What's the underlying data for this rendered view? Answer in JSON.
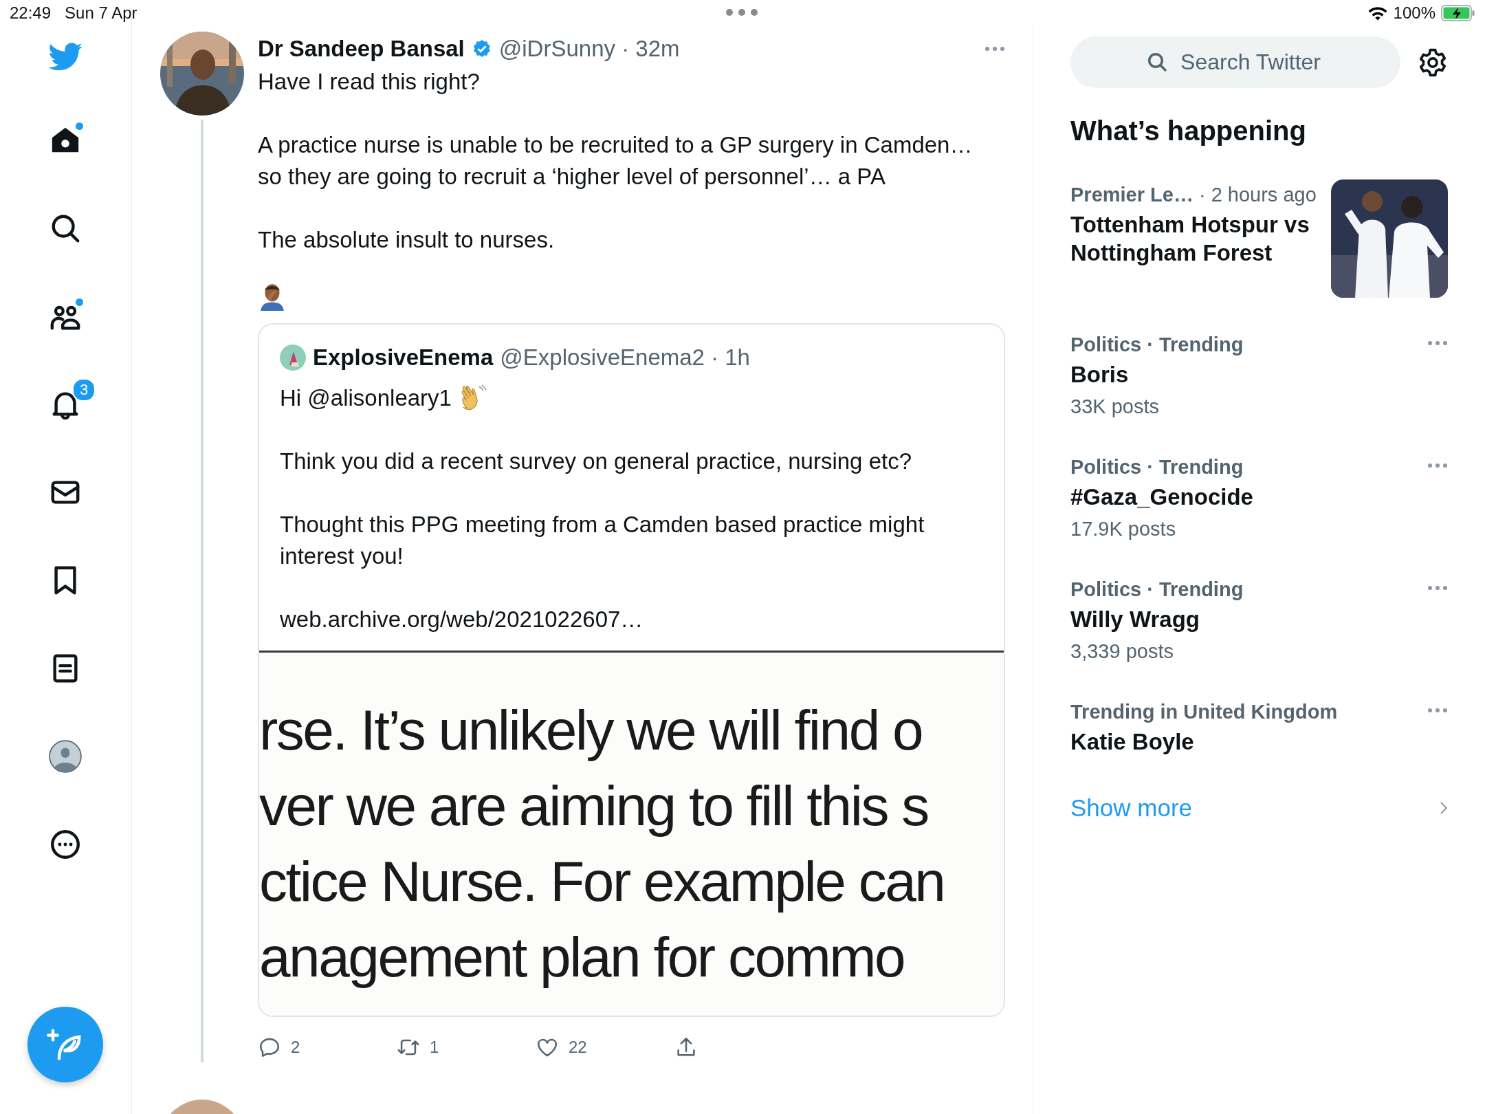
{
  "status_bar": {
    "time": "22:49",
    "date": "Sun 7 Apr",
    "battery": "100%"
  },
  "nav": [
    {
      "kind": "home",
      "selected": true,
      "dot": true
    },
    {
      "kind": "search",
      "selected": false,
      "dot": false
    },
    {
      "kind": "communities",
      "selected": false,
      "dot": true
    },
    {
      "kind": "notifications",
      "selected": false,
      "dot": false,
      "badge": "3"
    },
    {
      "kind": "messages",
      "selected": false,
      "dot": false
    },
    {
      "kind": "bookmarks",
      "selected": false,
      "dot": false
    },
    {
      "kind": "lists",
      "selected": false,
      "dot": false
    },
    {
      "kind": "profile",
      "selected": false,
      "dot": false
    },
    {
      "kind": "more",
      "selected": false,
      "dot": false
    }
  ],
  "tweet": {
    "author": "Dr Sandeep Bansal",
    "verified": true,
    "handle_time": "@iDrSunny · 32m",
    "paragraphs": [
      "Have I read this right?",
      "A practice nurse is unable to be recruited to a GP surgery in Camden… so they are going to recruit a ‘higher level of personnel’… a PA",
      "The absolute insult to nurses."
    ],
    "quote": {
      "author": "ExplosiveEnema",
      "handle_time": "@ExplosiveEnema2 · 1h",
      "greeting": "Hi @alisonleary1",
      "paragraphs": [
        "Think you did a recent survey on general practice, nursing etc?",
        "Thought this PPG meeting from a Camden based practice might interest you!"
      ],
      "link": "web.archive.org/web/2021022607…",
      "document_lines": [
        "rse. It’s unlikely we will find o",
        "ver we are aiming to fill this s",
        "ctice Nurse. For example can",
        "anagement plan for commo"
      ]
    },
    "actions": [
      {
        "kind": "reply",
        "count": "2"
      },
      {
        "kind": "retweet",
        "count": "1"
      },
      {
        "kind": "like",
        "count": "22"
      },
      {
        "kind": "share"
      }
    ]
  },
  "search": {
    "placeholder": "Search Twitter"
  },
  "trends_title": "What’s happening",
  "trends": [
    {
      "kind": "event",
      "category": "Premier Le…",
      "time": "· 2 hours ago",
      "title": "Tottenham Hotspur vs Nottingham Forest"
    },
    {
      "kind": "trend",
      "category": "Politics · Trending",
      "title": "Boris",
      "posts": "33K posts"
    },
    {
      "kind": "trend",
      "category": "Politics · Trending",
      "title": "#Gaza_Genocide",
      "posts": "17.9K posts"
    },
    {
      "kind": "trend",
      "category": "Politics · Trending",
      "title": "Willy Wragg",
      "posts": "3,339 posts"
    },
    {
      "kind": "trend",
      "category": "Trending in United Kingdom",
      "title": "Katie Boyle"
    }
  ],
  "show_more": "Show more"
}
